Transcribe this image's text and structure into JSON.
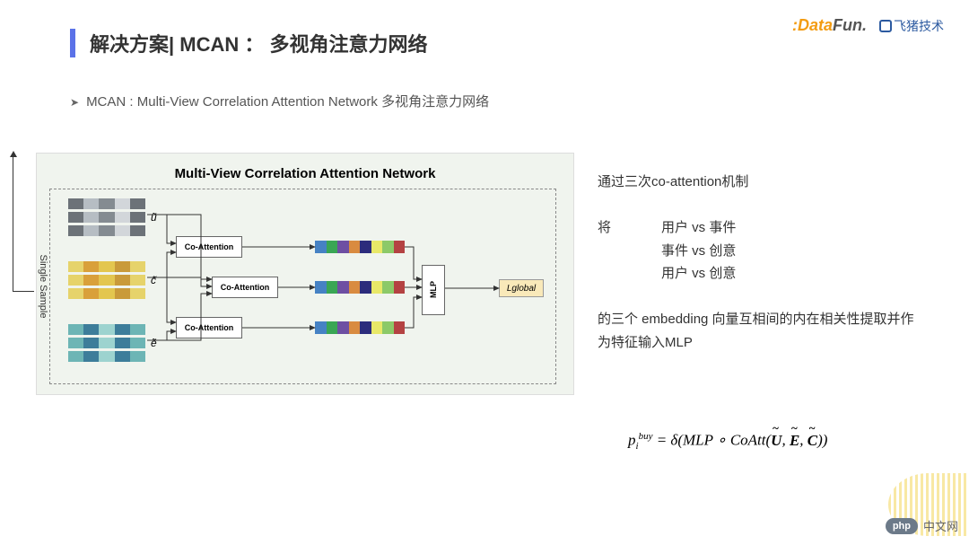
{
  "logos": {
    "datafun": "DataFun.",
    "feizhu": "飞猪技术"
  },
  "title": "解决方案| MCAN ： 多视角注意力网络",
  "subtitle": "MCAN : Multi-View Correlation Attention Network 多视角注意力网络",
  "diagram": {
    "title": "Multi-View Correlation Attention Network",
    "single_sample": "Single Sample",
    "u_tilde": "ũ",
    "c_tilde": "c̃",
    "e_tilde": "ẽ",
    "coattention": "Co-Attention",
    "mlp": "MLP",
    "l_global": "Lglobal"
  },
  "side": {
    "line1": "通过三次co-attention机制",
    "line2_prefix": "将",
    "pair1": "用户 vs 事件",
    "pair2": "事件 vs 创意",
    "pair3": "用户 vs 创意",
    "line3": "的三个 embedding 向量互相间的内在相关性提取并作为特征输入MLP"
  },
  "formula": {
    "lhs_p": "p",
    "lhs_sub": "i",
    "lhs_sup": "buy",
    "eq": " = δ(MLP ∘ CoAtt(",
    "u": "U",
    "e": "E",
    "c": "C",
    "sep": ", ",
    "end": "))"
  },
  "footer": {
    "php": "php",
    "cn": "中文网"
  }
}
